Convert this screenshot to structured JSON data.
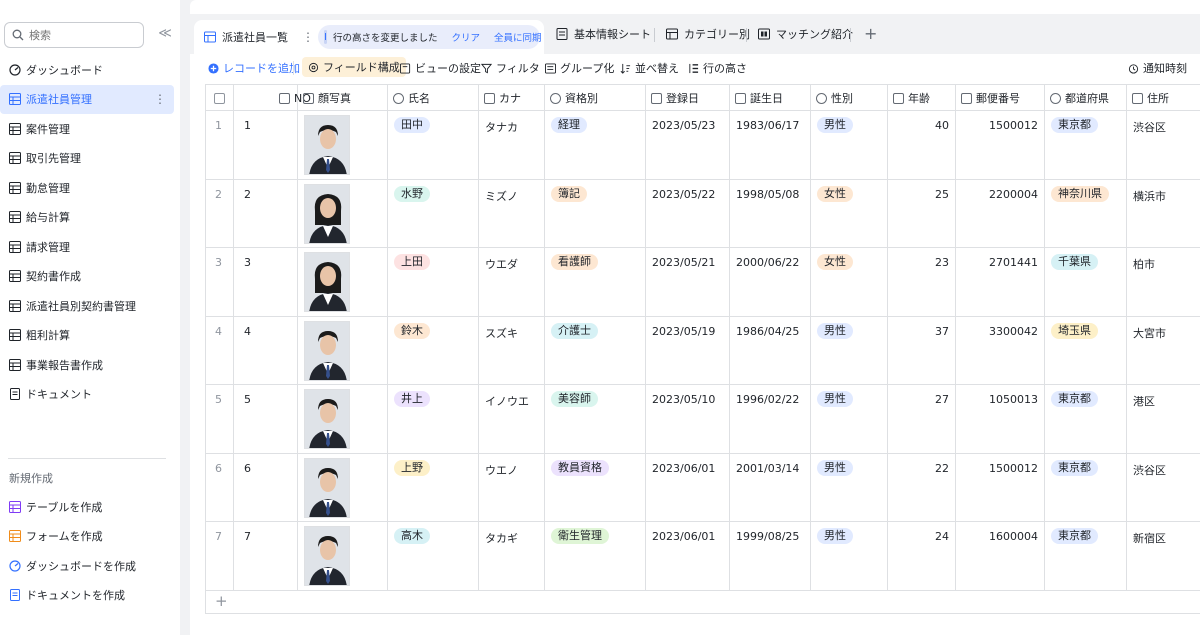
{
  "sidebar": {
    "search_placeholder": "検索",
    "collapse": "≪",
    "nav": [
      {
        "label": "ダッシュボード",
        "icon": "dashboard-icon",
        "active": false
      },
      {
        "label": "派遣社員管理",
        "icon": "grid-icon",
        "active": true
      },
      {
        "label": "案件管理",
        "icon": "grid-icon",
        "active": false
      },
      {
        "label": "取引先管理",
        "icon": "grid-icon",
        "active": false
      },
      {
        "label": "勤怠管理",
        "icon": "grid-icon",
        "active": false
      },
      {
        "label": "給与計算",
        "icon": "grid-icon",
        "active": false
      },
      {
        "label": "請求管理",
        "icon": "grid-icon",
        "active": false
      },
      {
        "label": "契約書作成",
        "icon": "grid-icon",
        "active": false
      },
      {
        "label": "派遣社員別契約書管理",
        "icon": "grid-icon",
        "active": false
      },
      {
        "label": "粗利計算",
        "icon": "grid-icon",
        "active": false
      },
      {
        "label": "事業報告書作成",
        "icon": "grid-icon",
        "active": false
      },
      {
        "label": "ドキュメント",
        "icon": "document-icon",
        "active": false
      }
    ],
    "new_title": "新規作成",
    "create": [
      {
        "label": "テーブルを作成",
        "icon": "table-create-icon",
        "color": "#7f3bf5"
      },
      {
        "label": "フォームを作成",
        "icon": "form-create-icon",
        "color": "#f08c1a"
      },
      {
        "label": "ダッシュボードを作成",
        "icon": "dashboard-create-icon",
        "color": "#3370ff"
      },
      {
        "label": "ドキュメントを作成",
        "icon": "document-create-icon",
        "color": "#3370ff"
      }
    ]
  },
  "tabs": {
    "active_label": "派遣社員一覧",
    "notice_text": "行の高さを変更しました",
    "notice_clear": "クリア",
    "notice_sync": "全員に同期",
    "others": [
      "基本情報シート",
      "カテゴリー別",
      "マッチング紹介"
    ]
  },
  "toolbar": {
    "add_record": "レコードを追加",
    "field_config": "フィールド構成",
    "view_settings": "ビューの設定",
    "filter": "フィルタ",
    "group": "グループ化",
    "sort": "並べ替え",
    "row_height": "行の高さ",
    "notify": "通知時刻"
  },
  "columns": [
    "NO",
    "顔写真",
    "氏名",
    "カナ",
    "資格別",
    "登録日",
    "誕生日",
    "性別",
    "年齢",
    "郵便番号",
    "都道府県",
    "住所"
  ],
  "colors": {
    "accent": "#3370ff",
    "active_bg": "#e1eaff"
  },
  "rows": [
    {
      "idx": "1",
      "no": "1",
      "name": "田中",
      "name_bg": "#e1eaff",
      "kana": "タナカ",
      "qual": "経理",
      "qual_bg": "#e1eaff",
      "reg": "2023/05/23",
      "birth": "1983/06/17",
      "sex": "男性",
      "sex_bg": "#e1eaff",
      "age": "40",
      "zip": "1500012",
      "pref": "東京都",
      "pref_bg": "#e1eaff",
      "addr": "渋谷区",
      "photo": "man"
    },
    {
      "idx": "2",
      "no": "2",
      "name": "水野",
      "name_bg": "#d9f5ee",
      "kana": "ミズノ",
      "qual": "簿記",
      "qual_bg": "#fde7d2",
      "reg": "2023/05/22",
      "birth": "1998/05/08",
      "sex": "女性",
      "sex_bg": "#fde7d2",
      "age": "25",
      "zip": "2200004",
      "pref": "神奈川県",
      "pref_bg": "#fde7d2",
      "addr": "横浜市",
      "photo": "woman"
    },
    {
      "idx": "3",
      "no": "3",
      "name": "上田",
      "name_bg": "#fde2e2",
      "kana": "ウエダ",
      "qual": "看護師",
      "qual_bg": "#fde7d2",
      "reg": "2023/05/21",
      "birth": "2000/06/22",
      "sex": "女性",
      "sex_bg": "#fde7d2",
      "age": "23",
      "zip": "2701441",
      "pref": "千葉県",
      "pref_bg": "#d6f1f5",
      "addr": "柏市",
      "photo": "woman"
    },
    {
      "idx": "4",
      "no": "4",
      "name": "鈴木",
      "name_bg": "#fde7d2",
      "kana": "スズキ",
      "qual": "介護士",
      "qual_bg": "#d6f1f5",
      "reg": "2023/05/19",
      "birth": "1986/04/25",
      "sex": "男性",
      "sex_bg": "#e1eaff",
      "age": "37",
      "zip": "3300042",
      "pref": "埼玉県",
      "pref_bg": "#fdf0c8",
      "addr": "大宮市",
      "photo": "man"
    },
    {
      "idx": "5",
      "no": "5",
      "name": "井上",
      "name_bg": "#ece2fd",
      "kana": "イノウエ",
      "qual": "美容師",
      "qual_bg": "#d9f5ee",
      "reg": "2023/05/10",
      "birth": "1996/02/22",
      "sex": "男性",
      "sex_bg": "#e1eaff",
      "age": "27",
      "zip": "1050013",
      "pref": "東京都",
      "pref_bg": "#e1eaff",
      "addr": "港区",
      "photo": "man"
    },
    {
      "idx": "6",
      "no": "6",
      "name": "上野",
      "name_bg": "#fdf0c8",
      "kana": "ウエノ",
      "qual": "教員資格",
      "qual_bg": "#ece2fd",
      "reg": "2023/06/01",
      "birth": "2001/03/14",
      "sex": "男性",
      "sex_bg": "#e1eaff",
      "age": "22",
      "zip": "1500012",
      "pref": "東京都",
      "pref_bg": "#e1eaff",
      "addr": "渋谷区",
      "photo": "man"
    },
    {
      "idx": "7",
      "no": "7",
      "name": "高木",
      "name_bg": "#d6f1f5",
      "kana": "タカギ",
      "qual": "衛生管理",
      "qual_bg": "#dff5d6",
      "reg": "2023/06/01",
      "birth": "1999/08/25",
      "sex": "男性",
      "sex_bg": "#e1eaff",
      "age": "24",
      "zip": "1600004",
      "pref": "東京都",
      "pref_bg": "#e1eaff",
      "addr": "新宿区",
      "photo": "man"
    }
  ],
  "add_row": "+"
}
